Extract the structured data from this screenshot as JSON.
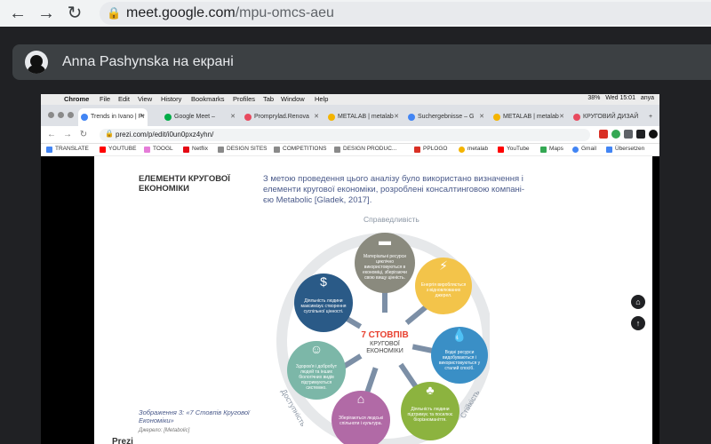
{
  "outer_browser": {
    "back": "←",
    "forward": "→",
    "reload": "↻",
    "url_host": "meet.google.com",
    "url_path": "/mpu-omcs-aeu"
  },
  "meet": {
    "presenter_text": "Anna Pashynska на екрані"
  },
  "mac_menu": {
    "items": [
      "Chrome",
      "File",
      "Edit",
      "View",
      "History",
      "Bookmarks",
      "Profiles",
      "Tab",
      "Window",
      "Help"
    ],
    "battery": "38%",
    "clock": "Wed 15:01",
    "user": "anya"
  },
  "inner_tabs": [
    {
      "label": "Trends in Ivano | Pr",
      "color": "#4285f4"
    },
    {
      "label": "Google Meet –",
      "color": "#00ac47"
    },
    {
      "label": "Promprylad.Renova",
      "color": "#e84a5f"
    },
    {
      "label": "METALAB | metalab",
      "color": "#f4b400"
    },
    {
      "label": "Suchergebnisse – G",
      "color": "#4285f4"
    },
    {
      "label": "METALAB | metalab",
      "color": "#f4b400"
    },
    {
      "label": "КРУГОВИЙ ДИЗАЙ",
      "color": "#e84a5f"
    }
  ],
  "inner_url": "prezi.com/p/edit/i0un0pxz4yhn/",
  "bookmarks": [
    "TRANSLATE",
    "YOUTUBE",
    "TOOGL",
    "Netflix",
    "DESIGN SITES",
    "COMPETITIONS",
    "DESIGN PRODUC...",
    "PPLOGO",
    "metalab",
    "YouTube",
    "Maps",
    "Gmail",
    "Übersetzen"
  ],
  "slide": {
    "heading": "ЕЛЕМЕНТИ КРУГОВОЇ ЕКОНОМІКИ",
    "paragraph": "З метою проведення цього аналізу було використано визначення і елементи кругової економіки, розроблені консалтинговою компані-єю Metabolic [Gladek, 2017].",
    "caption": "Зображення 3: «7 Стовпів Кругової Економіки»",
    "caption_source": "Джерело: [Metabolic]",
    "prezi_logo": "Prezi"
  },
  "diagram": {
    "ring_top": "Справедливість",
    "ring_left": "Доступність",
    "ring_right": "Стійкість",
    "center_number": "7 СТОВПІВ",
    "center_sub": "КРУГОВОЇ ЕКОНОМІКИ",
    "petals": [
      {
        "text": "Матеріальні ресурси циклічно використовуються в економіці, зберігаючи свою вищу цінність.",
        "color": "#8a8a7e",
        "icon": "▬"
      },
      {
        "text": "Енергія виробляється з відновлюваних джерел.",
        "color": "#f3c44a",
        "icon": "⚡"
      },
      {
        "text": "Водні ресурси видобуваються і використовуються у сталий спосіб.",
        "color": "#3a8fc6",
        "icon": "💧"
      },
      {
        "text": "Діяльність людини підтримує та посилює біорізноманіття.",
        "color": "#8cb33f",
        "icon": "♣"
      },
      {
        "text": "Зберігаються людські спільноти і культура.",
        "color": "#b16aa6",
        "icon": "⌂"
      },
      {
        "text": "Здоров'я і добробут людей та інших біологічних видів підтримуються системно.",
        "color": "#7cb7a8",
        "icon": "☺"
      },
      {
        "text": "Діяльність людини максимізує створення суспільної цінності.",
        "color": "#2a5a87",
        "icon": "$"
      }
    ]
  },
  "side_buttons": [
    "⌂",
    "↑"
  ]
}
